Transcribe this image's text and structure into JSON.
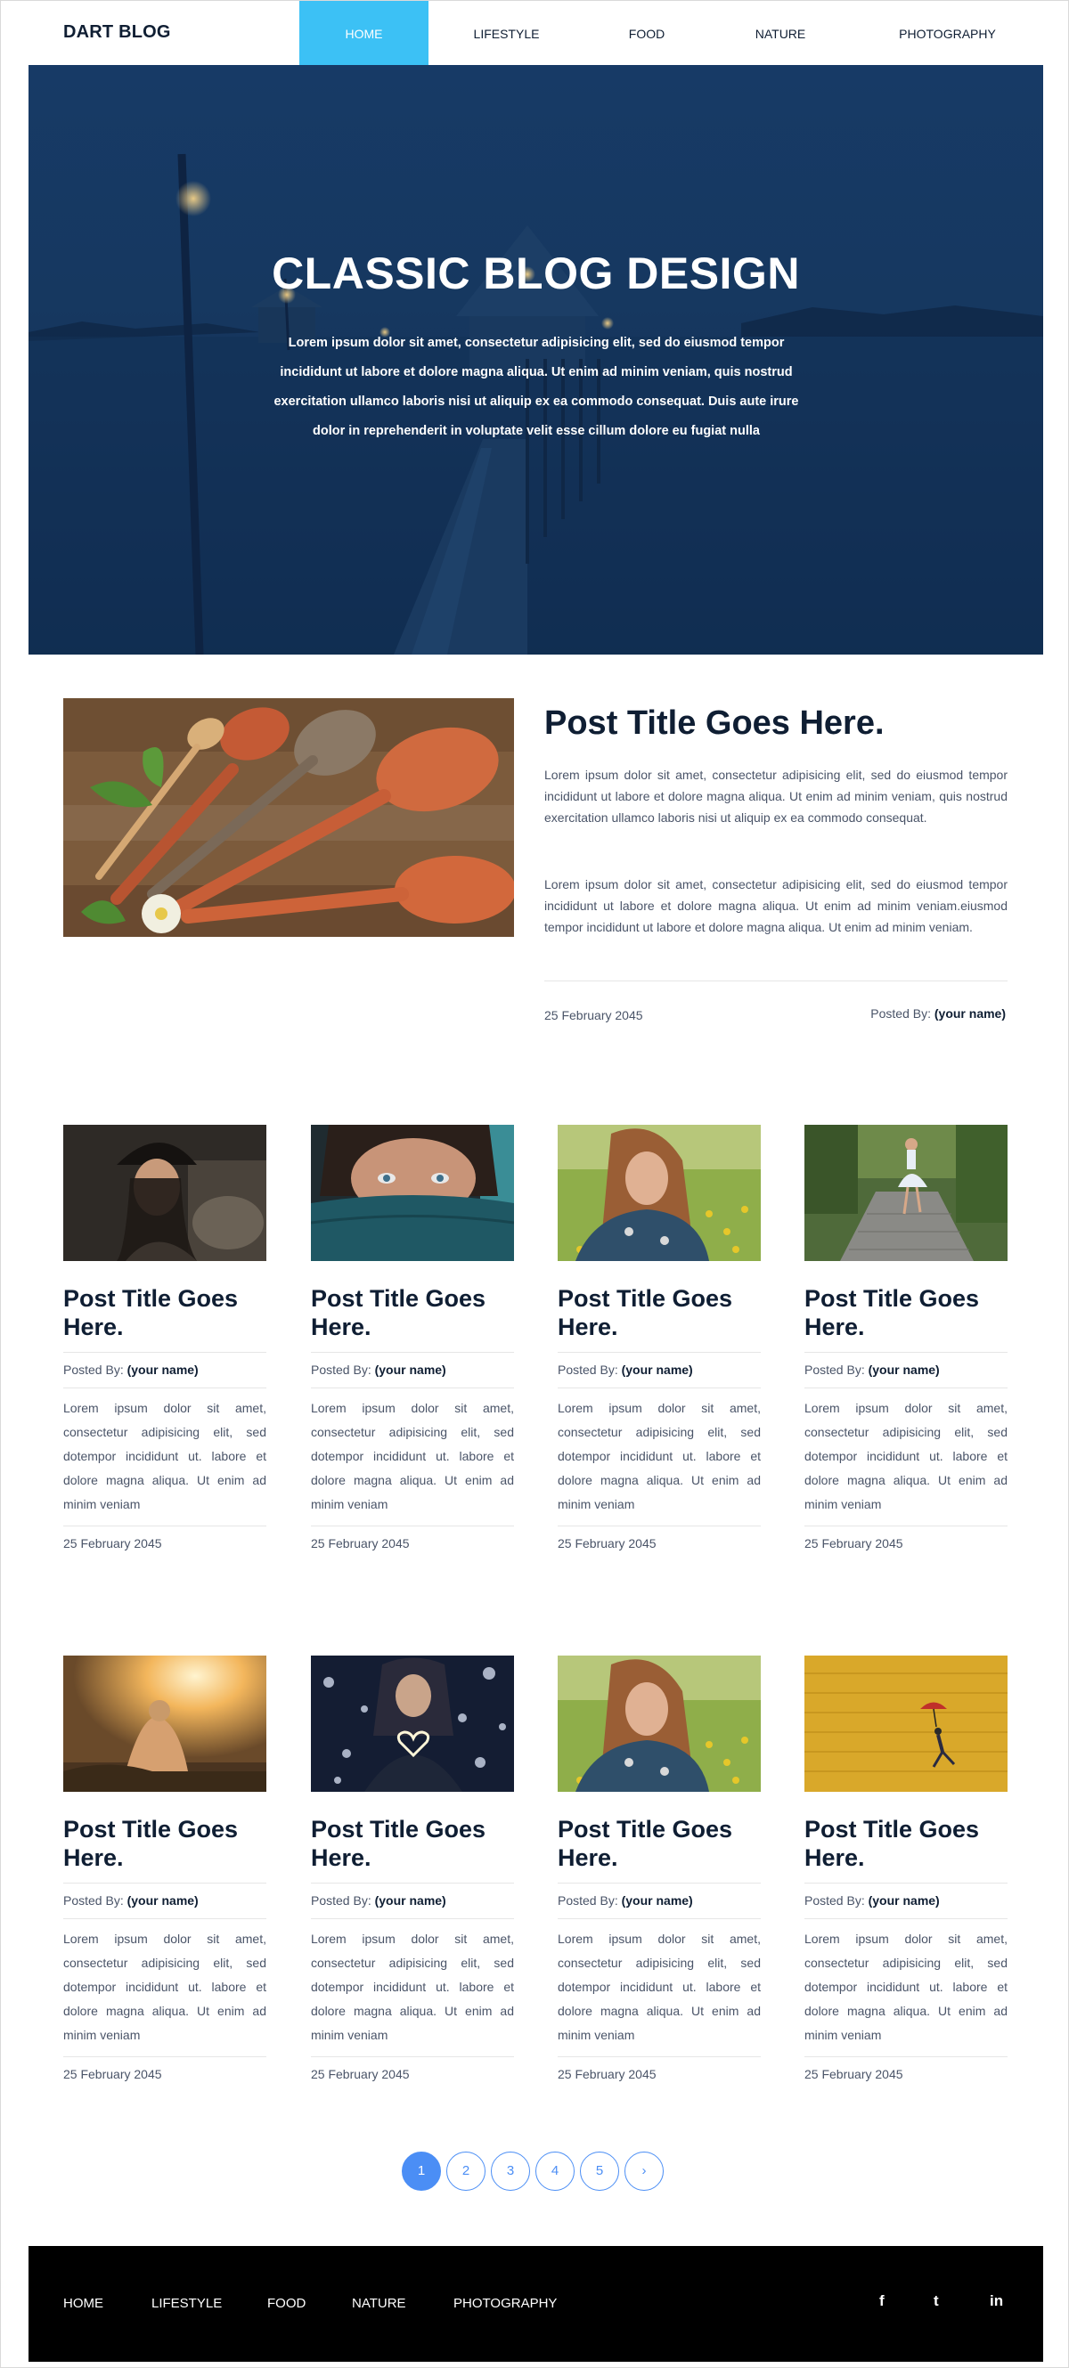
{
  "brand": "DART BLOG",
  "nav": {
    "items": [
      {
        "label": "HOME",
        "active": true
      },
      {
        "label": "LIFESTYLE",
        "active": false
      },
      {
        "label": "FOOD",
        "active": false
      },
      {
        "label": "NATURE",
        "active": false
      },
      {
        "label": "PHOTOGRAPHY",
        "active": false
      }
    ]
  },
  "hero": {
    "title": "CLASSIC BLOG DESIGN",
    "text": "Lorem ipsum dolor sit amet, consectetur adipisicing elit, sed do eiusmod tempor incididunt ut labore et dolore magna aliqua. Ut enim ad minim veniam, quis nostrud exercitation ullamco laboris nisi ut aliquip ex ea commodo consequat. Duis aute irure dolor in reprehenderit in voluptate velit esse cillum dolore eu fugiat nulla"
  },
  "featured": {
    "title": "Post Title Goes Here.",
    "paragraph1": "Lorem ipsum dolor sit amet, consectetur adipisicing elit, sed do eiusmod tempor incididunt ut labore et dolore magna aliqua. Ut enim ad minim veniam, quis nostrud exercitation ullamco laboris nisi ut aliquip ex ea commodo consequat.",
    "paragraph2": "Lorem ipsum dolor sit amet, consectetur adipisicing elit, sed do eiusmod tempor incididunt ut labore et dolore magna aliqua. Ut enim ad minim veniam.eiusmod tempor incididunt ut labore et dolore magna aliqua. Ut enim ad minim veniam.",
    "date": "25 February 2045",
    "posted_by_label": "Posted By:",
    "posted_by_name": "(your name)"
  },
  "posts": {
    "row1": [
      {
        "title": "Post Title Goes Here.",
        "posted_by_label": "Posted By:",
        "author": "(your name)",
        "excerpt": "Lorem ipsum dolor sit amet, consectetur adipisicing elit, sed dotempor incididunt ut. labore et dolore magna aliqua. Ut enim ad minim veniam",
        "date": "25 February 2045"
      },
      {
        "title": "Post Title Goes Here.",
        "posted_by_label": "Posted By:",
        "author": "(your name)",
        "excerpt": "Lorem ipsum dolor sit amet, consectetur adipisicing elit, sed dotempor incididunt ut. labore et dolore magna aliqua. Ut enim ad minim veniam",
        "date": "25 February 2045"
      },
      {
        "title": "Post Title Goes Here.",
        "posted_by_label": "Posted By:",
        "author": "(your name)",
        "excerpt": "Lorem ipsum dolor sit amet, consectetur adipisicing elit, sed dotempor incididunt ut. labore et dolore magna aliqua. Ut enim ad minim veniam",
        "date": "25 February 2045"
      },
      {
        "title": "Post Title Goes Here.",
        "posted_by_label": "Posted By:",
        "author": "(your name)",
        "excerpt": "Lorem ipsum dolor sit amet, consectetur adipisicing elit, sed dotempor incididunt ut. labore et dolore magna aliqua. Ut enim ad minim veniam",
        "date": "25 February 2045"
      }
    ],
    "row2": [
      {
        "title": "Post Title Goes Here.",
        "posted_by_label": "Posted By:",
        "author": "(your name)",
        "excerpt": "Lorem ipsum dolor sit amet, consectetur adipisicing elit, sed dotempor incididunt ut. labore et dolore magna aliqua. Ut enim ad minim veniam",
        "date": "25 February 2045"
      },
      {
        "title": "Post Title Goes Here.",
        "posted_by_label": "Posted By:",
        "author": "(your name)",
        "excerpt": "Lorem ipsum dolor sit amet, consectetur adipisicing elit, sed dotempor incididunt ut. labore et dolore magna aliqua. Ut enim ad minim veniam",
        "date": "25 February 2045"
      },
      {
        "title": "Post Title Goes Here.",
        "posted_by_label": "Posted By:",
        "author": "(your name)",
        "excerpt": "Lorem ipsum dolor sit amet, consectetur adipisicing elit, sed dotempor incididunt ut. labore et dolore magna aliqua. Ut enim ad minim veniam",
        "date": "25 February 2045"
      },
      {
        "title": "Post Title Goes Here.",
        "posted_by_label": "Posted By:",
        "author": "(your name)",
        "excerpt": "Lorem ipsum dolor sit amet, consectetur adipisicing elit, sed dotempor incididunt ut. labore et dolore magna aliqua. Ut enim ad minim veniam",
        "date": "25 February 2045"
      }
    ]
  },
  "pagination": {
    "pages": [
      "1",
      "2",
      "3",
      "4",
      "5"
    ],
    "current": "1",
    "next": "›"
  },
  "footer": {
    "links": [
      "HOME",
      "LIFESTYLE",
      "FOOD",
      "NATURE",
      "PHOTOGRAPHY"
    ],
    "social": {
      "facebook": "f",
      "twitter": "t",
      "linkedin": "in"
    }
  },
  "colors": {
    "accent": "#3cc1f5",
    "pager": "#4b8ef5",
    "heading": "#0f1e33",
    "body_text": "#4a5468",
    "footer_bg": "#000000"
  }
}
